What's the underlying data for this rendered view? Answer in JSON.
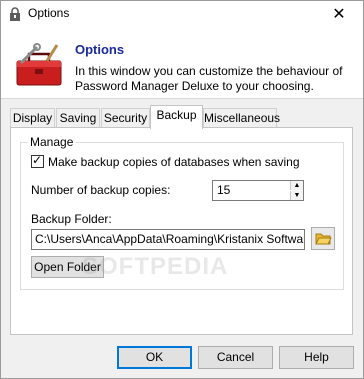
{
  "window": {
    "title": "Options",
    "close_glyph": "✕"
  },
  "header": {
    "title": "Options",
    "description": "In this window you can customize the behaviour of Password Manager Deluxe to your choosing."
  },
  "tabs": [
    {
      "label": "Display",
      "active": false
    },
    {
      "label": "Saving",
      "active": false
    },
    {
      "label": "Security",
      "active": false
    },
    {
      "label": "Backup",
      "active": true
    },
    {
      "label": "Miscellaneous",
      "active": false
    }
  ],
  "backup": {
    "group_label": "Manage",
    "make_copies": {
      "label": "Make backup copies of databases when saving",
      "checked": true,
      "mark": "✓"
    },
    "copies": {
      "label": "Number of backup copies:",
      "value": "15"
    },
    "folder": {
      "label": "Backup Folder:",
      "value": "C:\\Users\\Anca\\AppData\\Roaming\\Kristanix Software\\Pa"
    },
    "open_folder_label": "Open Folder"
  },
  "buttons": {
    "ok": "OK",
    "cancel": "Cancel",
    "help": "Help"
  },
  "watermark": "SOFTPEDIA",
  "icons": {
    "app": "lock-icon",
    "header": "toolbox-icon",
    "browse": "folder-icon",
    "spin_up": "spin-up-arrow-icon",
    "spin_down": "spin-down-arrow-icon"
  },
  "colors": {
    "header_title": "#1a2a9c",
    "toolbox": "#c81e1e",
    "folder": "#e8b730",
    "focus": "#0078d7"
  }
}
